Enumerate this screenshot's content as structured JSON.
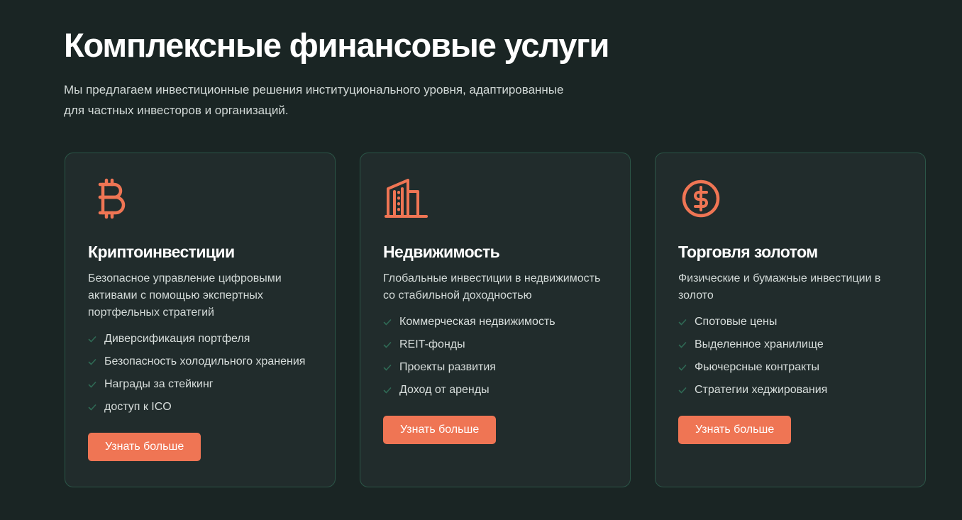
{
  "section": {
    "title": "Комплексные финансовые услуги",
    "subtitle_line1": "Мы предлагаем инвестиционные решения институционального уровня, адаптированные",
    "subtitle_line2": "для частных инвесторов и организаций."
  },
  "colors": {
    "background": "#1a2524",
    "card_background": "#212c2c",
    "card_border": "#2b5547",
    "accent": "#ef7554",
    "check": "#2f6a55"
  },
  "cards": [
    {
      "icon": "bitcoin-icon",
      "title": "Криптоинвестиции",
      "description": "Безопасное управление цифровыми активами с помощью экспертных портфельных стратегий",
      "features": [
        "Диверсификация портфеля",
        "Безопасность холодильного хранения",
        "Награды за стейкинг",
        "доступ к ICO"
      ],
      "button": "Узнать больше"
    },
    {
      "icon": "building-icon",
      "title": "Недвижимость",
      "description": "Глобальные инвестиции в недвижимость со стабильной доходностью",
      "features": [
        "Коммерческая недвижимость",
        "REIT-фонды",
        "Проекты развития",
        "Доход от аренды"
      ],
      "button": "Узнать больше"
    },
    {
      "icon": "dollar-circle-icon",
      "title": "Торговля золотом",
      "description": "Физические и бумажные инвестиции в золото",
      "features": [
        "Спотовые цены",
        "Выделенное хранилище",
        "Фьючерсные контракты",
        "Стратегии хеджирования"
      ],
      "button": "Узнать больше"
    }
  ]
}
